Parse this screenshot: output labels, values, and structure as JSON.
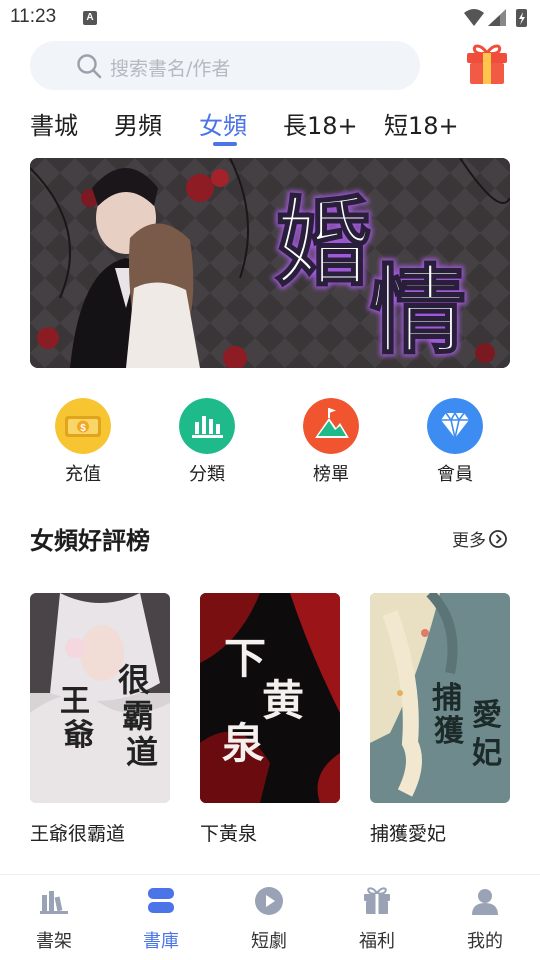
{
  "status_bar": {
    "time": "11:23",
    "notification_badge": "A"
  },
  "search": {
    "placeholder": "搜索書名/作者"
  },
  "tabs": [
    {
      "label": "書城"
    },
    {
      "label": "男頻"
    },
    {
      "label": "女頻"
    },
    {
      "label": "長18+"
    },
    {
      "label": "短18+"
    }
  ],
  "active_tab": "女頻",
  "banner": {
    "title_line1": "婚",
    "title_line2": "情"
  },
  "quick_menu": [
    {
      "label": "充值",
      "icon": "coin-icon",
      "color": "#f7c531"
    },
    {
      "label": "分類",
      "icon": "bar-chart-icon",
      "color": "#1fba8a"
    },
    {
      "label": "榜單",
      "icon": "mountain-flag-icon",
      "color": "#f0552f"
    },
    {
      "label": "會員",
      "icon": "diamond-icon",
      "color": "#3d8cf2"
    }
  ],
  "section": {
    "title": "女頻好評榜",
    "more_label": "更多"
  },
  "books": [
    {
      "title": "王爺很霸道",
      "cover_text": [
        "很",
        "霸",
        "道",
        "王",
        "爺"
      ]
    },
    {
      "title": "下黃泉",
      "cover_text": [
        "下",
        "黄",
        "泉"
      ]
    },
    {
      "title": "捕獲愛妃",
      "cover_text": [
        "捕",
        "獲",
        "愛",
        "妃"
      ]
    }
  ],
  "bottom_nav": [
    {
      "label": "書架",
      "icon": "bookshelf-icon"
    },
    {
      "label": "書庫",
      "icon": "library-icon",
      "active": true
    },
    {
      "label": "短劇",
      "icon": "play-icon"
    },
    {
      "label": "福利",
      "icon": "gift-icon"
    },
    {
      "label": "我的",
      "icon": "user-icon"
    }
  ],
  "colors": {
    "accent": "#4a74e8",
    "search_bg": "#f1f4f8",
    "placeholder": "#b4b9c2"
  }
}
